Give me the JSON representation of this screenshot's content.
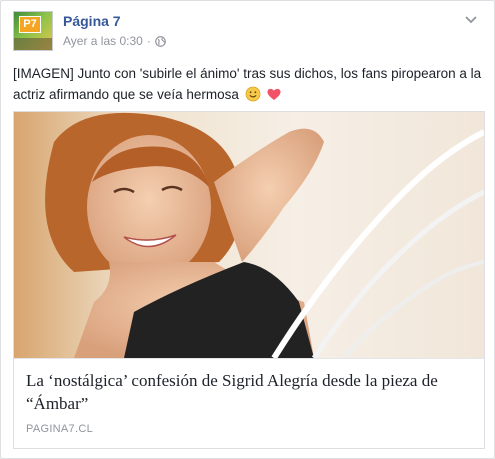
{
  "post": {
    "page_name": "Página 7",
    "avatar_badge": "P7",
    "timestamp": "Ayer a las 0:30",
    "separator": "·",
    "text": "[IMAGEN] Junto con 'subirle el ánimo' tras sus dichos, los fans piropearon a la actriz afirmando que se veía hermosa",
    "emojis": [
      "smiling-face-emoji",
      "heart-emoji"
    ]
  },
  "link_preview": {
    "title": "La ‘nostálgica’ confesión de Sigrid Alegría desde la pieza de “Ámbar”",
    "domain": "PAGINA7.CL"
  },
  "colors": {
    "page_name": "#365899",
    "meta_text": "#90949c",
    "body_text": "#1d2129",
    "border": "#dddfe2"
  }
}
